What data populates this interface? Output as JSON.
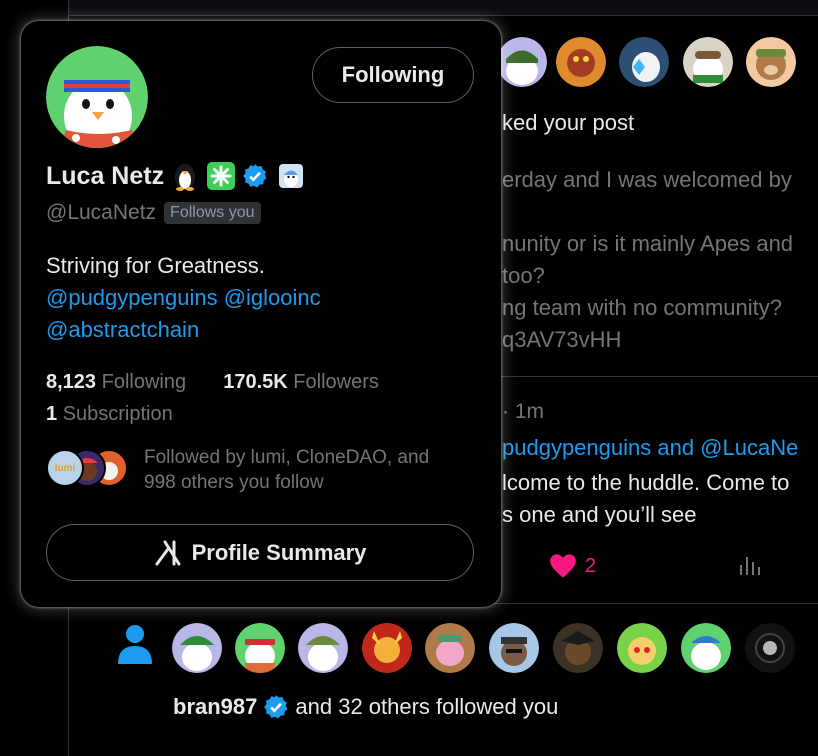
{
  "feed": {
    "liked_text": "ked your post",
    "post_lines": [
      "erday and I was welcomed by",
      "nunity or is it mainly Apes and",
      "too?",
      "ng team with no community?",
      "q3AV73vHH"
    ],
    "reply": {
      "time": "· 1m",
      "mention_line": "pudgypenguins and @LucaNe",
      "line1": "lcome to the huddle. Come to",
      "line2": "s one and you’ll see",
      "likes": "2"
    },
    "follow_notice": {
      "user": "bran987",
      "text": "and 32 others followed you"
    }
  },
  "card": {
    "follow_button": "Following",
    "name": "Luca Netz",
    "handle": "@LucaNetz",
    "follows_you": "Follows you",
    "bio_line1": "Striving for Greatness.",
    "bio_mention1": "@pudgypenguins",
    "bio_mention2": "@iglooinc",
    "bio_mention3": "@abstractchain",
    "following_count": "8,123",
    "following_label": "Following",
    "followers_count": "170.5K",
    "followers_label": "Followers",
    "subscription_count": "1",
    "subscription_label": "Subscription",
    "mutual_line1": "Followed by lumi, CloneDAO, and",
    "mutual_line2": "998 others you follow",
    "mutual_avatar_text": "lumi",
    "summary_button": "Profile Summary"
  },
  "colors": {
    "accent": "#1d9bf0",
    "like": "#f91880",
    "muted": "#71767b"
  }
}
